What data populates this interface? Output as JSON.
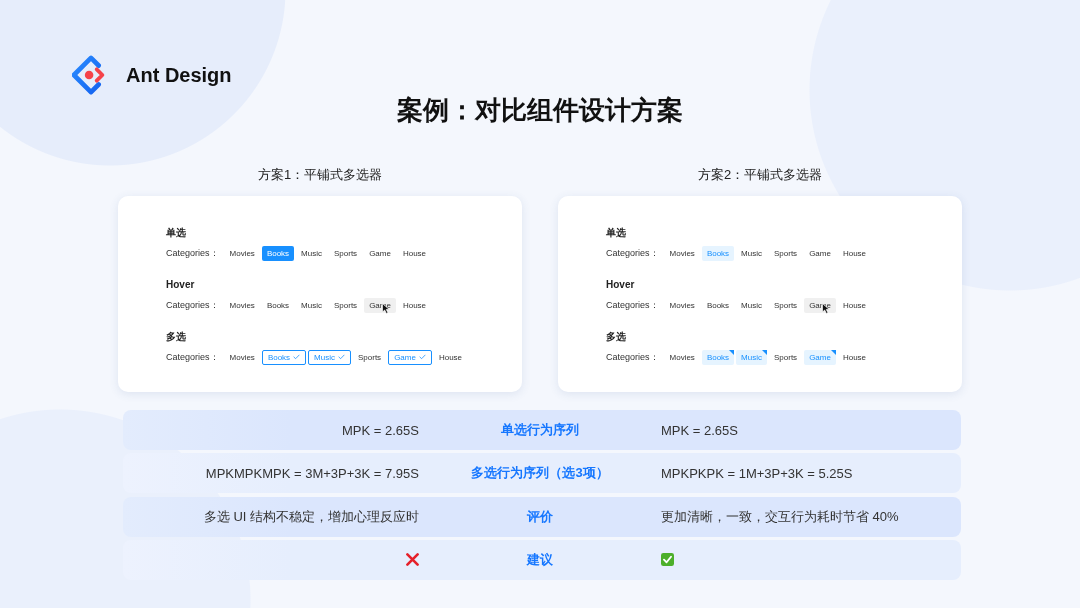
{
  "logo": {
    "name": "Ant Design"
  },
  "title": "案例：对比组件设计方案",
  "plans": [
    {
      "title": "方案1：平铺式多选器",
      "kind": "filled",
      "sections": [
        {
          "heading": "单选",
          "kind": "single",
          "label": "Categories：",
          "tags": [
            {
              "text": "Movies",
              "selected": false,
              "hovered": false
            },
            {
              "text": "Books",
              "selected": true,
              "hovered": false
            },
            {
              "text": "Music",
              "selected": false,
              "hovered": false
            },
            {
              "text": "Sports",
              "selected": false,
              "hovered": false
            },
            {
              "text": "Game",
              "selected": false,
              "hovered": false
            },
            {
              "text": "House",
              "selected": false,
              "hovered": false
            }
          ]
        },
        {
          "heading": "Hover",
          "kind": "hover",
          "label": "Categories：",
          "tags": [
            {
              "text": "Movies",
              "selected": false,
              "hovered": false
            },
            {
              "text": "Books",
              "selected": false,
              "hovered": false
            },
            {
              "text": "Music",
              "selected": false,
              "hovered": false
            },
            {
              "text": "Sports",
              "selected": false,
              "hovered": false
            },
            {
              "text": "Game",
              "selected": false,
              "hovered": true
            },
            {
              "text": "House",
              "selected": false,
              "hovered": false
            }
          ]
        },
        {
          "heading": "多选",
          "kind": "multi",
          "label": "Categories：",
          "tags": [
            {
              "text": "Movies",
              "selected": false,
              "hovered": false
            },
            {
              "text": "Books",
              "selected": true,
              "hovered": false
            },
            {
              "text": "Music",
              "selected": true,
              "hovered": false
            },
            {
              "text": "Sports",
              "selected": false,
              "hovered": false
            },
            {
              "text": "Game",
              "selected": true,
              "hovered": false
            },
            {
              "text": "House",
              "selected": false,
              "hovered": false
            }
          ]
        }
      ]
    },
    {
      "title": "方案2：平铺式多选器",
      "kind": "light",
      "sections": [
        {
          "heading": "单选",
          "kind": "single",
          "label": "Categories：",
          "tags": [
            {
              "text": "Movies",
              "selected": false,
              "hovered": false
            },
            {
              "text": "Books",
              "selected": true,
              "hovered": false
            },
            {
              "text": "Music",
              "selected": false,
              "hovered": false
            },
            {
              "text": "Sports",
              "selected": false,
              "hovered": false
            },
            {
              "text": "Game",
              "selected": false,
              "hovered": false
            },
            {
              "text": "House",
              "selected": false,
              "hovered": false
            }
          ]
        },
        {
          "heading": "Hover",
          "kind": "hover",
          "label": "Categories：",
          "tags": [
            {
              "text": "Movies",
              "selected": false,
              "hovered": false
            },
            {
              "text": "Books",
              "selected": false,
              "hovered": false
            },
            {
              "text": "Music",
              "selected": false,
              "hovered": false
            },
            {
              "text": "Sports",
              "selected": false,
              "hovered": false
            },
            {
              "text": "Game",
              "selected": false,
              "hovered": true
            },
            {
              "text": "House",
              "selected": false,
              "hovered": false
            }
          ]
        },
        {
          "heading": "多选",
          "kind": "multi",
          "label": "Categories：",
          "tags": [
            {
              "text": "Movies",
              "selected": false,
              "hovered": false
            },
            {
              "text": "Books",
              "selected": true,
              "hovered": false
            },
            {
              "text": "Music",
              "selected": true,
              "hovered": false
            },
            {
              "text": "Sports",
              "selected": false,
              "hovered": false
            },
            {
              "text": "Game",
              "selected": true,
              "hovered": false
            },
            {
              "text": "House",
              "selected": false,
              "hovered": false
            }
          ]
        }
      ]
    }
  ],
  "comparison": {
    "rows": [
      {
        "label": "单选行为序列",
        "option_1": {
          "kind": "text",
          "text": "MPK = 2.65S"
        },
        "option_2": {
          "kind": "text",
          "text": "MPK = 2.65S"
        }
      },
      {
        "label": "多选行为序列（选3项）",
        "option_1": {
          "kind": "text",
          "text": "MPKMPKMPK = 3M+3P+3K = 7.95S"
        },
        "option_2": {
          "kind": "text",
          "text": "MPKPKPK = 1M+3P+3K = 5.25S"
        }
      },
      {
        "label": "评价",
        "option_1": {
          "kind": "text",
          "text": "多选 UI 结构不稳定，增加心理反应时"
        },
        "option_2": {
          "kind": "text",
          "text": "更加清晰，一致，交互行为耗时节省 40%"
        }
      },
      {
        "label": "建议",
        "option_1": {
          "kind": "verdict",
          "recommended": false
        },
        "option_2": {
          "kind": "verdict",
          "recommended": true
        }
      }
    ]
  }
}
